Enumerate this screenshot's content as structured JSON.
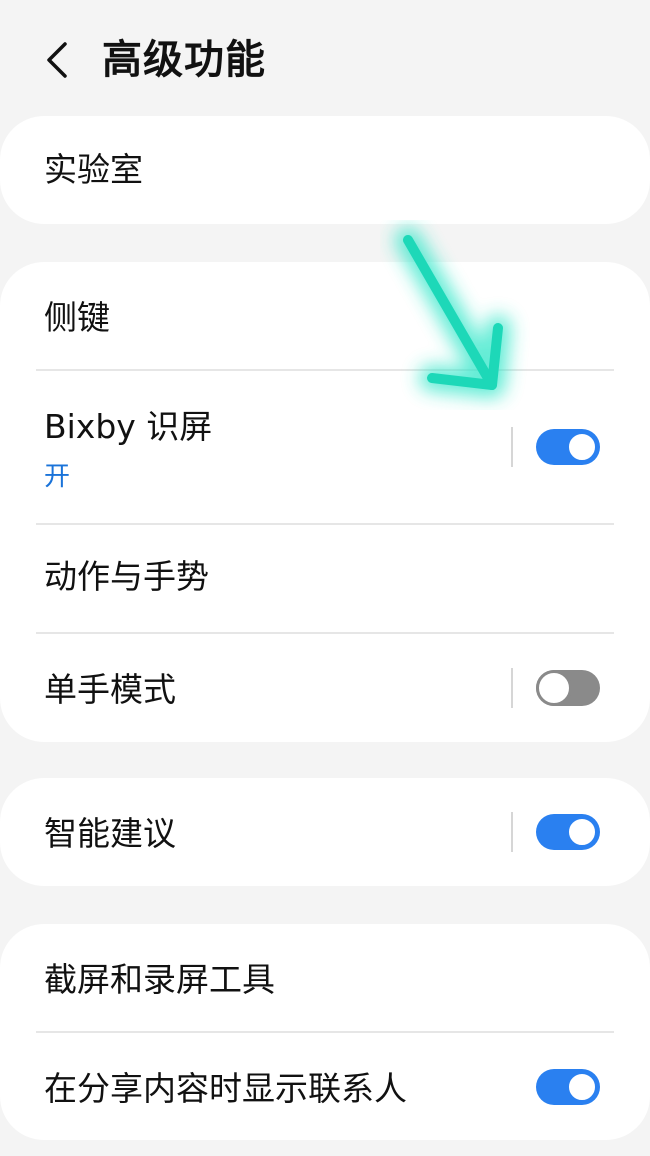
{
  "header": {
    "title": "高级功能",
    "back_icon": "chevron-left-icon"
  },
  "sections": [
    {
      "items": [
        {
          "label": "实验室"
        }
      ]
    },
    {
      "items": [
        {
          "label": "侧键"
        },
        {
          "label": "Bixby 识屏",
          "sub": "开",
          "toggle": true
        },
        {
          "label": "动作与手势"
        },
        {
          "label": "单手模式",
          "toggle": false
        }
      ]
    },
    {
      "items": [
        {
          "label": "智能建议",
          "toggle": true
        }
      ]
    },
    {
      "items": [
        {
          "label": "截屏和录屏工具"
        },
        {
          "label": "在分享内容时显示联系人",
          "toggle": true
        }
      ]
    }
  ],
  "colors": {
    "accent": "#2a80f0",
    "sub_text": "#1a73d9",
    "annotation_arrow": "#2ee6c8",
    "background": "#f4f4f4",
    "card": "#ffffff"
  }
}
